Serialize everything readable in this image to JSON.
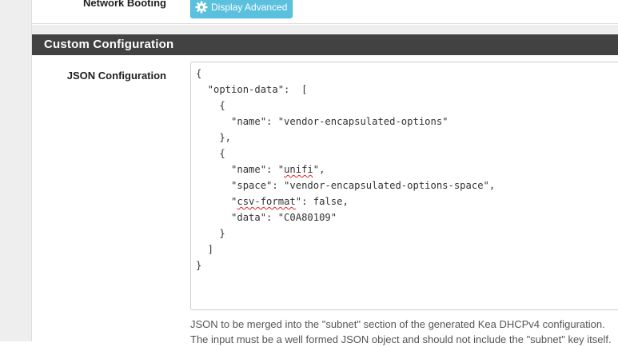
{
  "top_row": {
    "label": "Network Booting",
    "advanced_button_label": "Display Advanced",
    "advanced_button_icon": "gear-icon"
  },
  "section": {
    "title": "Custom Configuration"
  },
  "json_config": {
    "label": "JSON Configuration",
    "lines": [
      "{",
      "  \"option-data\":  [",
      "    {",
      "      \"name\": \"vendor-encapsulated-options\"",
      "    },",
      "    {",
      "      \"name\": \"unifi\",",
      "      \"space\": \"vendor-encapsulated-options-space\",",
      "      \"csv-format\": false,",
      "      \"data\": \"C0A80109\"",
      "    }",
      "  ]",
      "}"
    ],
    "help_line_1": "JSON to be merged into the \"subnet\" section of the generated Kea DHCPv4 configuration.",
    "help_line_2": "The input must be a well formed JSON object and should not include the \"subnet\" key itself."
  },
  "colors": {
    "heading_bg": "#424242",
    "button_bg": "#5bc0de",
    "page_bg": "#eeeeee"
  }
}
